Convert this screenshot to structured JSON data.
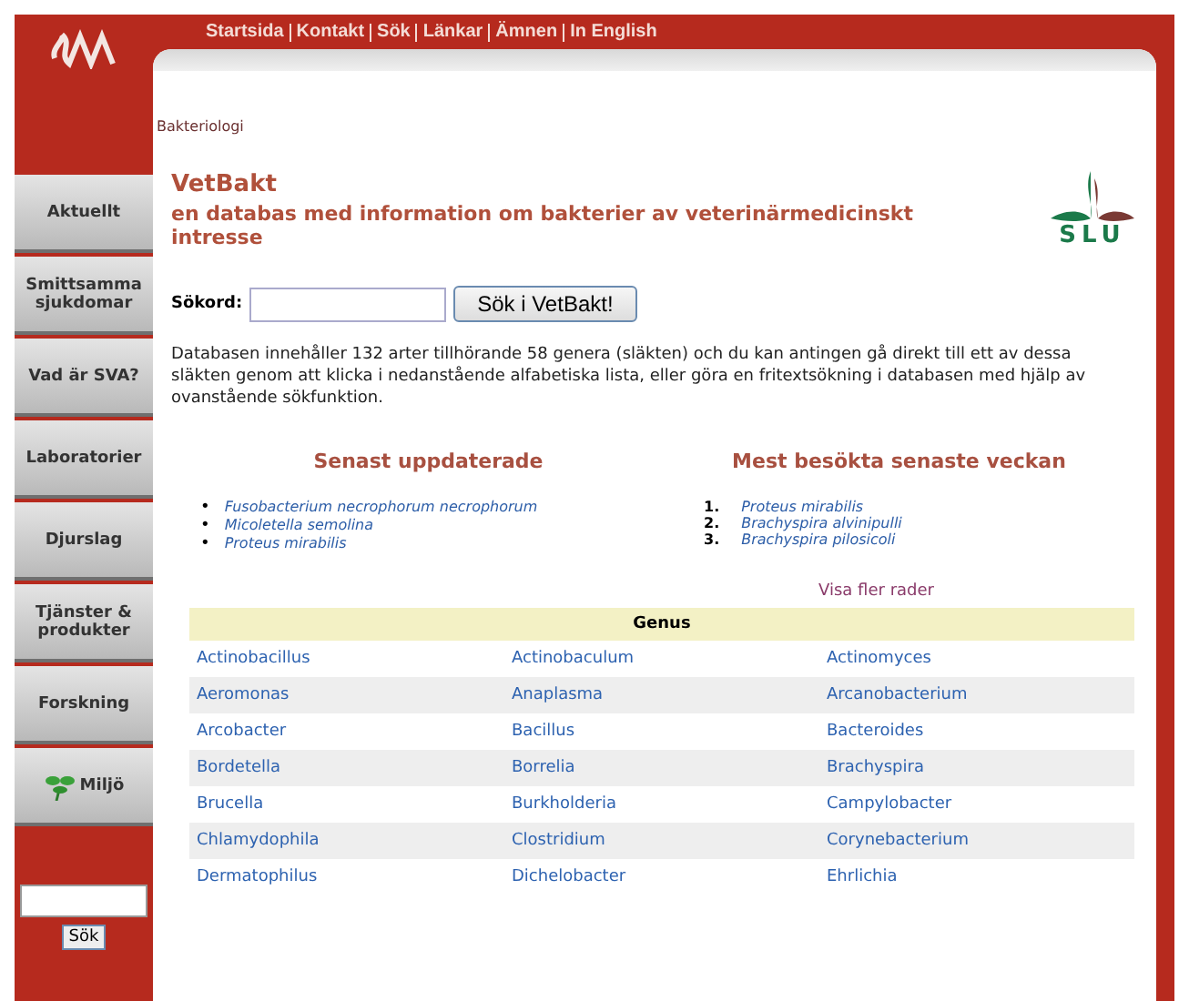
{
  "top_nav": [
    "Startsida",
    "Kontakt",
    "Sök",
    "Länkar",
    "Ämnen",
    "In English"
  ],
  "sidebar": {
    "items": [
      {
        "label": "Aktuellt",
        "kind": "plain"
      },
      {
        "label": "Smittsamma sjukdomar",
        "kind": "plain"
      },
      {
        "label": "Vad är SVA?",
        "kind": "plain"
      },
      {
        "label": "Laboratorier",
        "kind": "plain"
      },
      {
        "label": "Djurslag",
        "kind": "plain"
      },
      {
        "label": "Tjänster & produkter",
        "kind": "plain"
      },
      {
        "label": "Forskning",
        "kind": "plain"
      },
      {
        "label": "Miljö",
        "kind": "plant"
      }
    ],
    "search_button": "Sök"
  },
  "breadcrumb": "Bakteriologi",
  "title": "VetBakt",
  "subtitle": "en databas med information om bakterier av veterinärmedicinskt intresse",
  "search": {
    "label": "Sökord:",
    "button": "Sök i VetBakt!"
  },
  "intro": "Databasen innehåller 132 arter tillhörande 58 genera (släkten) och du kan antingen gå direkt till ett av dessa släkten genom att klicka i nedanstående alfabetiska lista, eller göra en fritextsökning i databasen med hjälp av ovanstående sökfunktion.",
  "logo_text": "SLU",
  "recent": {
    "heading": "Senast uppdaterade",
    "items": [
      {
        "marker": "•",
        "name": "Fusobacterium necrophorum necrophorum"
      },
      {
        "marker": "•",
        "name": "Micoletella semolina"
      },
      {
        "marker": "•",
        "name": "Proteus mirabilis"
      }
    ]
  },
  "popular": {
    "heading": "Mest besökta senaste veckan",
    "items": [
      {
        "number": "1.",
        "name": "Proteus mirabilis"
      },
      {
        "number": "2.",
        "name": "Brachyspira alvinipulli"
      },
      {
        "number": "3.",
        "name": "Brachyspira pilosicoli"
      }
    ]
  },
  "more_link": "Visa fler rader",
  "table": {
    "title": "Genus",
    "rows": [
      [
        "Actinobacillus",
        "Actinobaculum",
        "Actinomyces"
      ],
      [
        "Aeromonas",
        "Anaplasma",
        "Arcanobacterium"
      ],
      [
        "Arcobacter",
        "Bacillus",
        "Bacteroides"
      ],
      [
        "Bordetella",
        "Borrelia",
        "Brachyspira"
      ],
      [
        "Brucella",
        "Burkholderia",
        "Campylobacter"
      ],
      [
        "Chlamydophila",
        "Clostridium",
        "Corynebacterium"
      ],
      [
        "Dermatophilus",
        "Dichelobacter",
        "Ehrlichia"
      ]
    ]
  }
}
